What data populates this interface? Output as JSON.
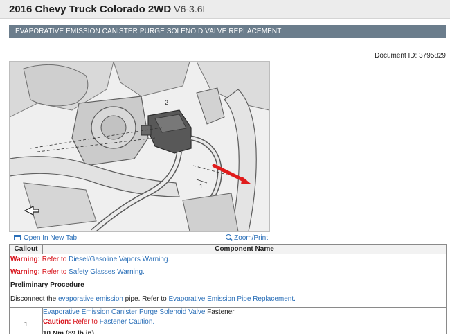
{
  "header": {
    "vehicle": "2016 Chevy Truck Colorado 2WD",
    "engine": "V6-3.6L"
  },
  "procedure": {
    "title": "EVAPORATIVE EMISSION CANISTER PURGE SOLENOID VALVE REPLACEMENT",
    "document_id": "Document ID: 3795829"
  },
  "figure": {
    "callout_1": "1",
    "callout_2": "2",
    "open_new_tab": "Open In New Tab",
    "zoom_print": "Zoom/Print"
  },
  "table": {
    "col_callout": "Callout",
    "col_component": "Component Name",
    "warning1": {
      "label": "Warning:",
      "refer": "Refer to",
      "link": "Diesel/Gasoline Vapors Warning",
      "end": "."
    },
    "warning2": {
      "label": "Warning:",
      "refer": "Refer to",
      "link": "Safety Glasses Warning",
      "end": "."
    },
    "preliminary": "Preliminary Procedure",
    "disconnect": {
      "pre": "Disconnect the",
      "link1": "evaporative emission",
      "mid": "pipe. Refer to",
      "link2": "Evaporative Emission Pipe Replacement",
      "end": "."
    },
    "row1": {
      "callout": "1",
      "component_link": "Evaporative Emission Canister Purge Solenoid Valve",
      "component_rest": "Fastener",
      "caution_label": "Caution:",
      "caution_refer": "Refer to",
      "caution_link": "Fastener Caution",
      "caution_end": ".",
      "torque": "10 Nm (89 lb in)"
    }
  },
  "colors": {
    "procbar": "#6b7d8c",
    "link": "#2a6fb8",
    "warning": "#d8141c",
    "pointer_arrow": "#e01b1b"
  }
}
